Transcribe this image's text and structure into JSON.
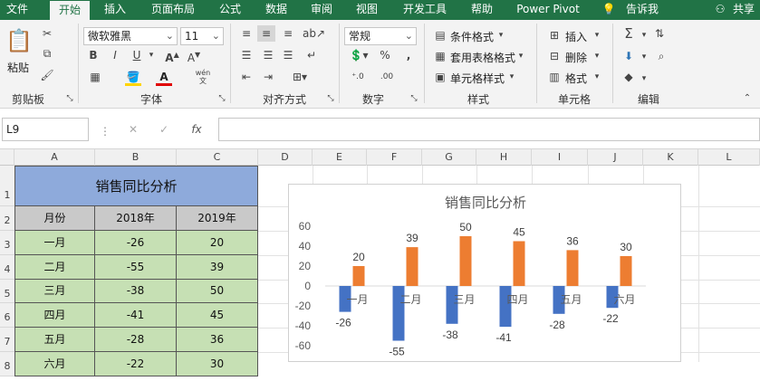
{
  "tabs": [
    "文件",
    "开始",
    "插入",
    "页面布局",
    "公式",
    "数据",
    "审阅",
    "视图",
    "开发工具",
    "帮助",
    "Power Pivot",
    "告诉我",
    "共享"
  ],
  "ribbon": {
    "clipboard": {
      "paste": "粘贴",
      "label": "剪贴板"
    },
    "font": {
      "name": "微软雅黑",
      "size": "11",
      "bold": "B",
      "italic": "I",
      "underline": "U",
      "grow": "A",
      "shrink": "A",
      "label": "字体",
      "font_color": "A",
      "wen": "wén"
    },
    "align": {
      "label": "对齐方式"
    },
    "number": {
      "format": "常规",
      "label": "数字",
      "pct": "%",
      "comma": ","
    },
    "styles": {
      "cond": "条件格式",
      "table": "套用表格格式",
      "cell": "单元格样式",
      "label": "样式"
    },
    "cells": {
      "insert": "插入",
      "delete": "删除",
      "format": "格式",
      "label": "单元格"
    },
    "edit": {
      "label": "编辑"
    }
  },
  "formula_bar": {
    "name_box": "L9",
    "cancel": "✕",
    "enter": "✓",
    "fx": "fx",
    "value": ""
  },
  "columns": [
    "A",
    "B",
    "C",
    "D",
    "E",
    "F",
    "G",
    "H",
    "I",
    "J",
    "K",
    "L"
  ],
  "rows": [
    "1",
    "2",
    "3",
    "4",
    "5",
    "6",
    "7",
    "8"
  ],
  "table": {
    "title": "销售同比分析",
    "headers": [
      "月份",
      "2018年",
      "2019年"
    ],
    "rows": [
      [
        "一月",
        "-26",
        "20"
      ],
      [
        "二月",
        "-55",
        "39"
      ],
      [
        "三月",
        "-38",
        "50"
      ],
      [
        "四月",
        "-41",
        "45"
      ],
      [
        "五月",
        "-28",
        "36"
      ],
      [
        "六月",
        "-22",
        "30"
      ]
    ]
  },
  "colors": {
    "excel_green": "#217346",
    "title_fill": "#8eaadb",
    "header_fill": "#c9c9c9",
    "data_fill": "#c6e0b4",
    "series_2018": "#4472c4",
    "series_2019": "#ed7d31"
  },
  "chart_data": {
    "type": "bar",
    "title": "销售同比分析",
    "categories": [
      "一月",
      "二月",
      "三月",
      "四月",
      "五月",
      "六月"
    ],
    "series": [
      {
        "values": [
          -26,
          -55,
          -38,
          -41,
          -28,
          -22
        ],
        "color": "#4472c4"
      },
      {
        "values": [
          20,
          39,
          50,
          45,
          36,
          30
        ],
        "color": "#ed7d31"
      }
    ],
    "yticks": [
      "60",
      "40",
      "20",
      "0",
      "-20",
      "-40",
      "-60"
    ],
    "ylim": [
      -60,
      60
    ],
    "grid": false
  }
}
